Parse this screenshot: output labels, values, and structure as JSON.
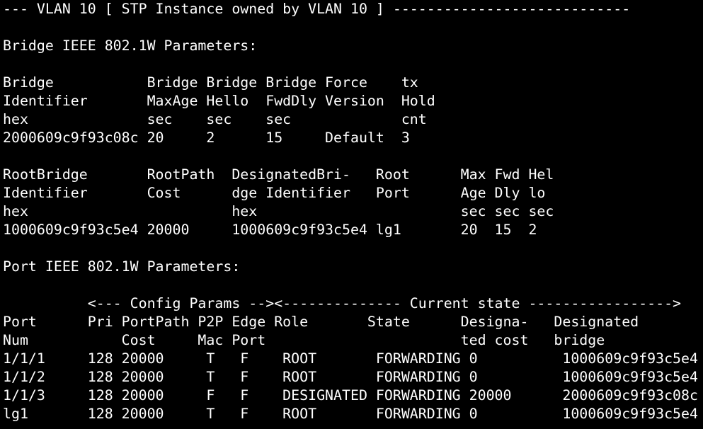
{
  "terminal": {
    "lines": [
      "--- VLAN 10 [ STP Instance owned by VLAN 10 ] ----------------------------",
      "",
      "Bridge IEEE 802.1W Parameters:",
      "",
      "Bridge           Bridge Bridge Bridge Force    tx",
      "Identifier       MaxAge Hello  FwdDly Version  Hold",
      "hex              sec    sec    sec             cnt",
      "2000609c9f93c08c 20     2      15     Default  3",
      "",
      "RootBridge       RootPath  DesignatedBri-   Root      Max Fwd Hel",
      "Identifier       Cost      dge Identifier   Port      Age Dly lo",
      "hex                        hex                        sec sec sec",
      "1000609c9f93c5e4 20000     1000609c9f93c5e4 lg1       20  15  2",
      "",
      "Port IEEE 802.1W Parameters:",
      "",
      "          <--- Config Params -->&lt;-------------- Current state ----------------->",
      "Port      Pri PortPath P2P Edge Role       State      Designa-   Designated",
      "Num           Cost     Mac Port                       ted cost   bridge",
      "1/1/1     128 20000     T   F    ROOT       FORWARDING 0          1000609c9f93c5e4",
      "1/1/2     128 20000     T   F    ROOT       FORWARDING 0          1000609c9f93c5e4",
      "1/1/3     128 20000     F   F    DESIGNATED FORWARDING 20000      2000609c9f93c08c",
      "lg1       128 20000     T   F    ROOT       FORWARDING 0          1000609c9f93c5e4"
    ]
  }
}
